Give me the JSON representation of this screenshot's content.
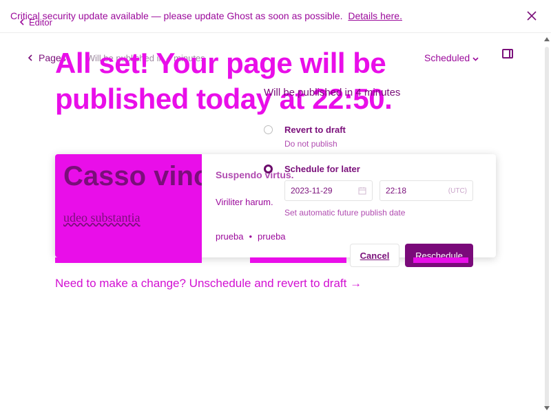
{
  "banner": {
    "text": "Critical security update available — please update Ghost as soon as possible.",
    "link": "Details here."
  },
  "editor": {
    "back_label": "Editor",
    "breadcrumb": "Pages",
    "subtitle": "Will be published in 4 minutes",
    "status": "Scheduled"
  },
  "hero": {
    "title": "All set! Your page will be published today at 22:50."
  },
  "schedule": {
    "will_publish": "Will be published in 4 minutes",
    "revert_title": "Revert to draft",
    "revert_sub": "Do not publish",
    "later_title": "Schedule for later",
    "date": "2023-11-29",
    "time": "22:18",
    "timezone": "(UTC)",
    "hint": "Set automatic future publish date",
    "cancel": "Cancel",
    "reschedule": "Reschedule"
  },
  "card": {
    "image_title": "Casso vincul",
    "image_subtitle": "udeo substantia",
    "heading": "Suspendo virtus.",
    "excerpt": "Viriliter harum.",
    "tags": [
      "prueba",
      "•",
      "prueba"
    ]
  },
  "footer": {
    "change_link": "Need to make a change? Unschedule and revert to draft →"
  },
  "colors": {
    "accent": "#e90ee9",
    "primary_dark": "#7a0a7a"
  }
}
